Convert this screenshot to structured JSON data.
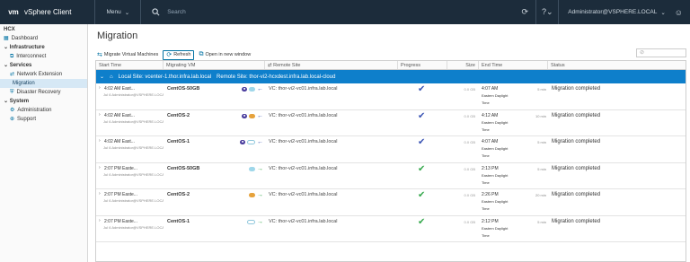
{
  "topbar": {
    "logo": "vm",
    "app_title": "vSphere Client",
    "menu_label": "Menu",
    "search_placeholder": "Search",
    "user": "Administrator@VSPHERE.LOCAL"
  },
  "sidebar": {
    "root": "HCX",
    "dashboard": "Dashboard",
    "sections": [
      {
        "label": "Infrastructure",
        "items": [
          "Interconnect"
        ]
      },
      {
        "label": "Services",
        "items": [
          "Network Extension",
          "Migration",
          "Disaster Recovery"
        ]
      },
      {
        "label": "System",
        "items": [
          "Administration",
          "Support"
        ]
      }
    ]
  },
  "main": {
    "title": "Migration",
    "toolbar": {
      "migrate_label": "Migrate Virtual Machines",
      "refresh_label": "Refresh",
      "new_window_label": "Open in new window"
    },
    "columns": [
      "Start Time",
      "Migrating VM",
      "Remote Site",
      "Progress",
      "Size",
      "End Time",
      "Status"
    ],
    "group": {
      "local": "Local Site: vcenter-1.thor.infra.lab.local",
      "remote": "Remote Site: thor-vi2-hcxdest.infra.lab.local-cloud"
    },
    "rows": [
      {
        "start": "4:02 AM East...",
        "user": "Jul 6  Administrator@VSPHERE.LOCAL",
        "vm": "CentOS-50GB",
        "badges": [
          "vm",
          "cyan"
        ],
        "direction": "left",
        "site": "VC: thor-vi2-vc01.infra.lab.local",
        "progress": "done-blue",
        "size": "0.0 GB",
        "end1": "4:07 AM",
        "end2": "Eastern Daylight",
        "end3": "Time",
        "dur": "5 min",
        "status": "Migration completed"
      },
      {
        "start": "4:02 AM East...",
        "user": "Jul 6  Administrator@VSPHERE.LOCAL",
        "vm": "CentOS-2",
        "badges": [
          "vm",
          "org"
        ],
        "direction": "left",
        "site": "VC: thor-vi2-vc01.infra.lab.local",
        "progress": "done-blue",
        "size": "0.0 GB",
        "end1": "4:12 AM",
        "end2": "Eastern Daylight",
        "end3": "Time",
        "dur": "10 min",
        "status": "Migration completed"
      },
      {
        "start": "4:02 AM East...",
        "user": "Jul 6  Administrator@VSPHERE.LOCAL",
        "vm": "CentOS-1",
        "badges": [
          "vm",
          "out"
        ],
        "direction": "left",
        "site": "VC: thor-vi2-vc01.infra.lab.local",
        "progress": "done-blue",
        "size": "0.0 GB",
        "end1": "4:07 AM",
        "end2": "Eastern Daylight",
        "end3": "Time",
        "dur": "5 min",
        "status": "Migration completed"
      },
      {
        "start": "2:07 PM Easte...",
        "user": "Jul 6  Administrator@VSPHERE.LOCAL",
        "vm": "CentOS-50GB",
        "badges": [
          "cyan"
        ],
        "direction": "right",
        "site": "VC: thor-vi2-vc01.infra.lab.local",
        "progress": "done-green",
        "size": "0.0 GB",
        "end1": "2:13 PM",
        "end2": "Eastern Daylight",
        "end3": "Time",
        "dur": "5 min",
        "status": "Migration completed"
      },
      {
        "start": "2:07 PM Easte...",
        "user": "Jul 6  Administrator@VSPHERE.LOCAL",
        "vm": "CentOS-2",
        "badges": [
          "org"
        ],
        "direction": "right",
        "site": "VC: thor-vi2-vc01.infra.lab.local",
        "progress": "done-green",
        "size": "0.0 GB",
        "end1": "2:26 PM",
        "end2": "Eastern Daylight",
        "end3": "Time",
        "dur": "20 min",
        "status": "Migration completed"
      },
      {
        "start": "2:07 PM Easte...",
        "user": "Jul 6  Administrator@VSPHERE.LOCAL",
        "vm": "CentOS-1",
        "badges": [
          "out"
        ],
        "direction": "right",
        "site": "VC: thor-vi2-vc01.infra.lab.local",
        "progress": "done-green",
        "size": "0.0 GB",
        "end1": "2:12 PM",
        "end2": "Eastern Daylight",
        "end3": "Time",
        "dur": "5 min",
        "status": "Migration completed"
      }
    ]
  },
  "colors": {
    "topbar": "#1c2c3b",
    "group_row": "#0e7fcb",
    "accent": "#0072a3",
    "check_blue": "#3a54b4",
    "check_green": "#35a84c"
  }
}
